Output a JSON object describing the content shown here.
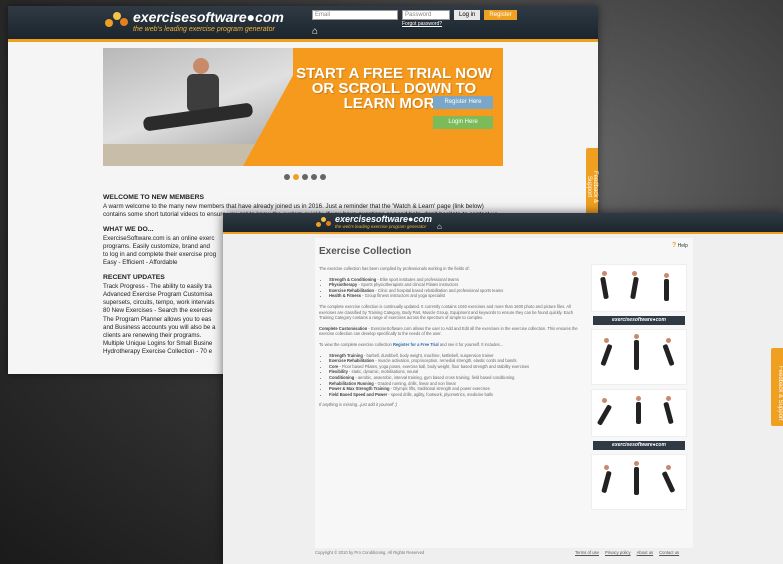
{
  "back_page": {
    "logo": {
      "title": "exercisesoftware●com",
      "tagline": "the web's leading exercise program generator"
    },
    "login": {
      "email_placeholder": "Email",
      "password_placeholder": "Password",
      "login_label": "Log in",
      "register_label": "Register",
      "forgot_label": "Forgot password?"
    },
    "hero": {
      "headline_1": "START A FREE TRIAL NOW",
      "headline_2": "OR SCROLL DOWN TO",
      "headline_3": "LEARN MORE",
      "register_button": "Register Here",
      "login_button": "Login Here"
    },
    "carousel": {
      "count": 5,
      "active_index": 1
    },
    "sections": {
      "welcome_title": "WELCOME TO NEW MEMBERS",
      "welcome_body": "A warm welcome to the many new members that have already joined us in 2016.  Just a reminder that the 'Watch & Learn' page (link below) contains some short tutorial videos to ensure you get to know the system quickly.  If you have questions or need help, don't hesitate to contact us.",
      "whatwedo_title": "WHAT WE DO...",
      "whatwedo_line1": "ExerciseSoftware.com is an online exerc",
      "whatwedo_line2": "programs.   Easily customize, brand and",
      "whatwedo_line3": "to log in and complete their exercise prog",
      "whatwedo_line4": "Easy - Efficient - Affordable",
      "updates_title": "RECENT UPDATES",
      "updates_lines": [
        " Track Progress - The ability to easily tra",
        " Advanced Exercise Program Customisa",
        "supersets, circuits, tempo, work intervals",
        " 80 New Exercises - Search the exercise",
        " The Program Planner allows you to eas",
        "and Business accounts you will also be a",
        "clients are renewing their programs.",
        " Multiple Unique Logins for Small Busine",
        " Hydrotherapy Exercise Collection - 70 e"
      ]
    },
    "feedback_tab": "Feedback & Support"
  },
  "front_page": {
    "logo": {
      "title": "exercisesoftware●com",
      "tagline": "the web's leading exercise program generator"
    },
    "title": "Exercise Collection",
    "help_label": "Help",
    "intro": "The exercise collection has been compiled by professionals working in the fields of:",
    "fields": [
      {
        "name": "Strength & Conditioning",
        "desc": " - Elite sport institutes and professional teams"
      },
      {
        "name": "Physiotherapy",
        "desc": " - Sports physiotherapists and clinical Pilates instructors"
      },
      {
        "name": "Exercise Rehabilitation",
        "desc": " - Clinic and hospital based rehabilitation and professional sports teams"
      },
      {
        "name": "Health & Fitness",
        "desc": " - Group fitness instructors and yoga specialist"
      }
    ],
    "para2": "The complete exercise collection is continually updated.  It currently contains 1040 exercises and more than 1600 photo and picture files.  All exercises are classified by Training Category, Body Part, Muscle Group, Equipment and keywords to ensure they can be found quickly.  Each Training Category contains a range of exercises across the spectrum of simple to complex.",
    "para3_bold": "Complete Customisation",
    "para3": " - ExerciseSoftware.com allows the user to Add and Edit all the exercises in the exercise collection. This ensures the exercise collection can develop specifically to the needs of the user.",
    "para4_prefix": "To view the complete exercise collection ",
    "para4_link": "Register for a Free Trial",
    "para4_suffix": " and see it for yourself. It includes...",
    "categories": [
      {
        "name": "Strength Training",
        "desc": " - barbell, dumbbell, body weight, machine, kettlebell, suspension trainer"
      },
      {
        "name": "Exercise Rehabilitation",
        "desc": " - muscle activation, proprioception, remedial strength, elastic cords and bands"
      },
      {
        "name": "Core",
        "desc": " - Floor based Pilates, yoga poses, exercise ball, body weight, floor based strength and stability exercises"
      },
      {
        "name": "Flexibility",
        "desc": " - static, dynamic, mobilisations, neural"
      },
      {
        "name": "Conditioning",
        "desc": " - aerobic, anaerobic, interval training, gym based cross training, field based conditioning"
      },
      {
        "name": "Rehabilitation Running",
        "desc": " - Graded running, drills, linear and non linear"
      },
      {
        "name": "Power & Max Strength Training",
        "desc": " - Olympic lifts, traditional strength and power exercises"
      },
      {
        "name": "Field Based Speed and Power",
        "desc": " - speed drills, agility, footwork, plyometrics, medicine balls"
      }
    ],
    "closing": "If anything is missing...just add it yourself :)",
    "gallery_banner": "exercisesoftware●com",
    "footer": {
      "copyright": "Copyright © 2010 by Pro Conditioning. All Rights Reserved",
      "links": [
        "Terms of use",
        "Privacy policy",
        "About us",
        "Contact us"
      ]
    },
    "feedback_tab": "Feedback & Support"
  },
  "colors": {
    "accent": "#f0a020",
    "header": "#2f3a44",
    "link": "#2a6aa8"
  }
}
